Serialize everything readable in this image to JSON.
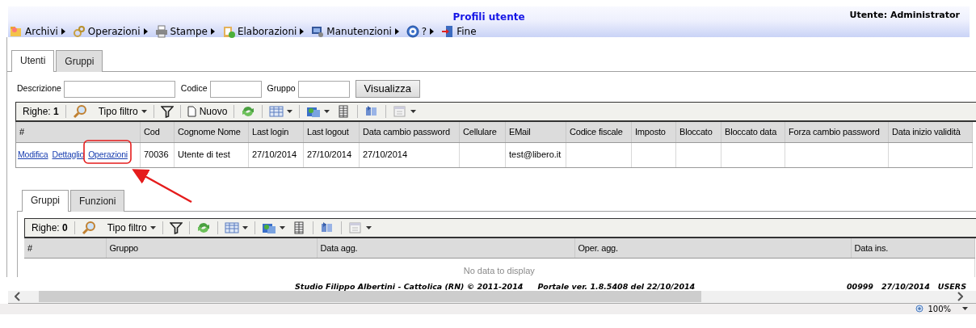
{
  "header": {
    "title": "Profili utente",
    "user": "Utente: Administrator"
  },
  "menu": [
    {
      "label": "Archivi",
      "has_submenu": true
    },
    {
      "label": "Operazioni",
      "has_submenu": true
    },
    {
      "label": "Stampe",
      "has_submenu": true
    },
    {
      "label": "Elaborazioni",
      "has_submenu": true
    },
    {
      "label": "Manutenzioni",
      "has_submenu": true
    },
    {
      "label": "?",
      "has_submenu": true
    },
    {
      "label": "Fine",
      "has_submenu": false
    }
  ],
  "tabs": [
    {
      "label": "Utenti",
      "selected": true
    },
    {
      "label": "Gruppi",
      "selected": false
    }
  ],
  "filters": [
    {
      "label": "Descrizione"
    },
    {
      "label": "Codice"
    },
    {
      "label": "Gruppo"
    }
  ],
  "search_button": "Visualizza",
  "users_grid": {
    "rows_label": "Righe:",
    "rows_count": "1",
    "filter_type": "Tipo filtro",
    "new_button": "Nuovo",
    "action_column": "#",
    "columns": [
      "Cod",
      "Cognome Nome",
      "Last login",
      "Last logout",
      "Data cambio password",
      "Cellulare",
      "EMail",
      "Codice fiscale",
      "Imposto",
      "Bloccato",
      "Bloccato data",
      "Forza cambio password",
      "Data inizio validità"
    ],
    "rows": [
      {
        "actions": [
          "Modifica",
          "Dettaglio",
          "Operazioni"
        ],
        "cells": [
          "70036",
          "Utente di test",
          "27/10/2014",
          "27/10/2014",
          "27/10/2014",
          "",
          "test@libero.it",
          "",
          "",
          "",
          "",
          "",
          ""
        ]
      }
    ]
  },
  "detail_tabs": [
    {
      "label": "Gruppi",
      "selected": true
    },
    {
      "label": "Funzioni",
      "selected": false
    }
  ],
  "groups_grid": {
    "rows_label": "Righe:",
    "rows_count": "0",
    "filter_type": "Tipo filtro",
    "columns": [
      "#",
      "Gruppo",
      "Data agg.",
      "Oper. agg.",
      "Data ins."
    ],
    "empty_text": "No data to display"
  },
  "footer": {
    "copyright": "Studio Filippo Albertini - Cattolica (RN) © 2011-2014",
    "version": "Portale ver. 1.8.5408 del 22/10/2014",
    "codes": [
      "00999",
      "27/10/2014",
      "USERS"
    ]
  },
  "status_bar": {
    "zoom": "100%"
  }
}
